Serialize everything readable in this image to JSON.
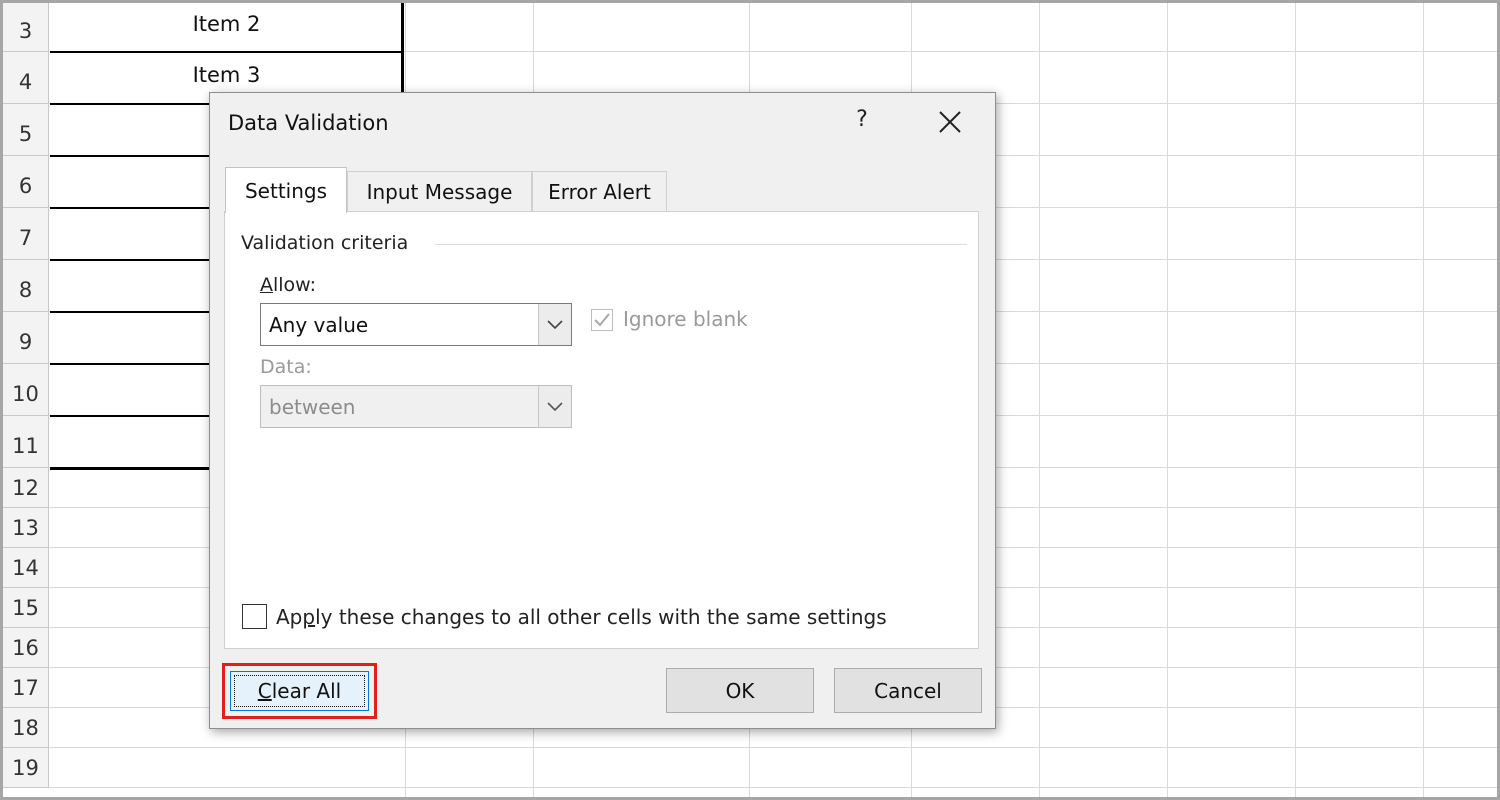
{
  "sheet": {
    "rows": [
      {
        "num": "3",
        "value": "Item 2"
      },
      {
        "num": "4",
        "value": "Item 3"
      },
      {
        "num": "5",
        "value": "It"
      },
      {
        "num": "6",
        "value": "It"
      },
      {
        "num": "7",
        "value": "It"
      },
      {
        "num": "8",
        "value": "It"
      },
      {
        "num": "9",
        "value": "It"
      },
      {
        "num": "10",
        "value": "It"
      },
      {
        "num": "11",
        "value": "Ite"
      },
      {
        "num": "12",
        "value": ""
      },
      {
        "num": "13",
        "value": ""
      },
      {
        "num": "14",
        "value": ""
      },
      {
        "num": "15",
        "value": ""
      },
      {
        "num": "16",
        "value": ""
      },
      {
        "num": "17",
        "value": ""
      },
      {
        "num": "18",
        "value": ""
      },
      {
        "num": "19",
        "value": ""
      }
    ]
  },
  "dialog": {
    "title": "Data Validation",
    "help_label": "?",
    "close_icon": "close-icon",
    "tabs": [
      {
        "label": "Settings",
        "active": true
      },
      {
        "label": "Input Message",
        "active": false
      },
      {
        "label": "Error Alert",
        "active": false
      }
    ],
    "settings": {
      "group_label": "Validation criteria",
      "allow_label_hotkey": "A",
      "allow_label_rest": "llow:",
      "allow_value": "Any value",
      "ignore_blank_label": "Ignore blank",
      "ignore_blank_checked": true,
      "data_label": "Data:",
      "data_value": "between",
      "apply_label_pre": "Ap",
      "apply_label_hotkey": "p",
      "apply_label_post": "ly these changes to all other cells with the same settings",
      "apply_checked": false
    },
    "buttons": {
      "clear_all_hotkey": "C",
      "clear_all_rest": "lear All",
      "ok": "OK",
      "cancel": "Cancel"
    },
    "highlight_color": "#e0201b"
  }
}
